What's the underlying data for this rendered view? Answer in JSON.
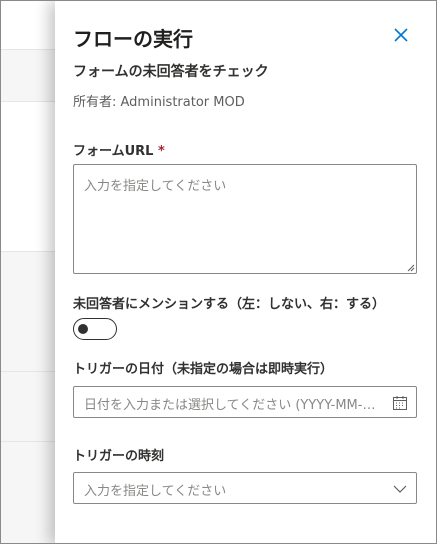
{
  "panel": {
    "title": "フローの実行",
    "subtitle": "フォームの未回答者をチェック",
    "owner": "所有者: Administrator MOD"
  },
  "form": {
    "url_label": "フォームURL",
    "required_mark": "*",
    "url_placeholder": "入力を指定してください",
    "mention_label": "未回答者にメンションする（左：しない、右：する）",
    "mention_toggle_on": false,
    "date_label": "トリガーの日付（未指定の場合は即時実行）",
    "date_placeholder": "日付を入力または選択してください (YYYY-MM-DD)",
    "time_label": "トリガーの時刻",
    "time_placeholder": "入力を指定してください"
  },
  "icons": {
    "close": "close-icon",
    "calendar": "calendar-icon",
    "dropdown": "chevron-down-icon",
    "resize": "resize-grip-icon"
  },
  "colors": {
    "accent": "#0078d4",
    "required": "#a4262c",
    "border": "#8a8886",
    "placeholder": "#8a8886"
  }
}
